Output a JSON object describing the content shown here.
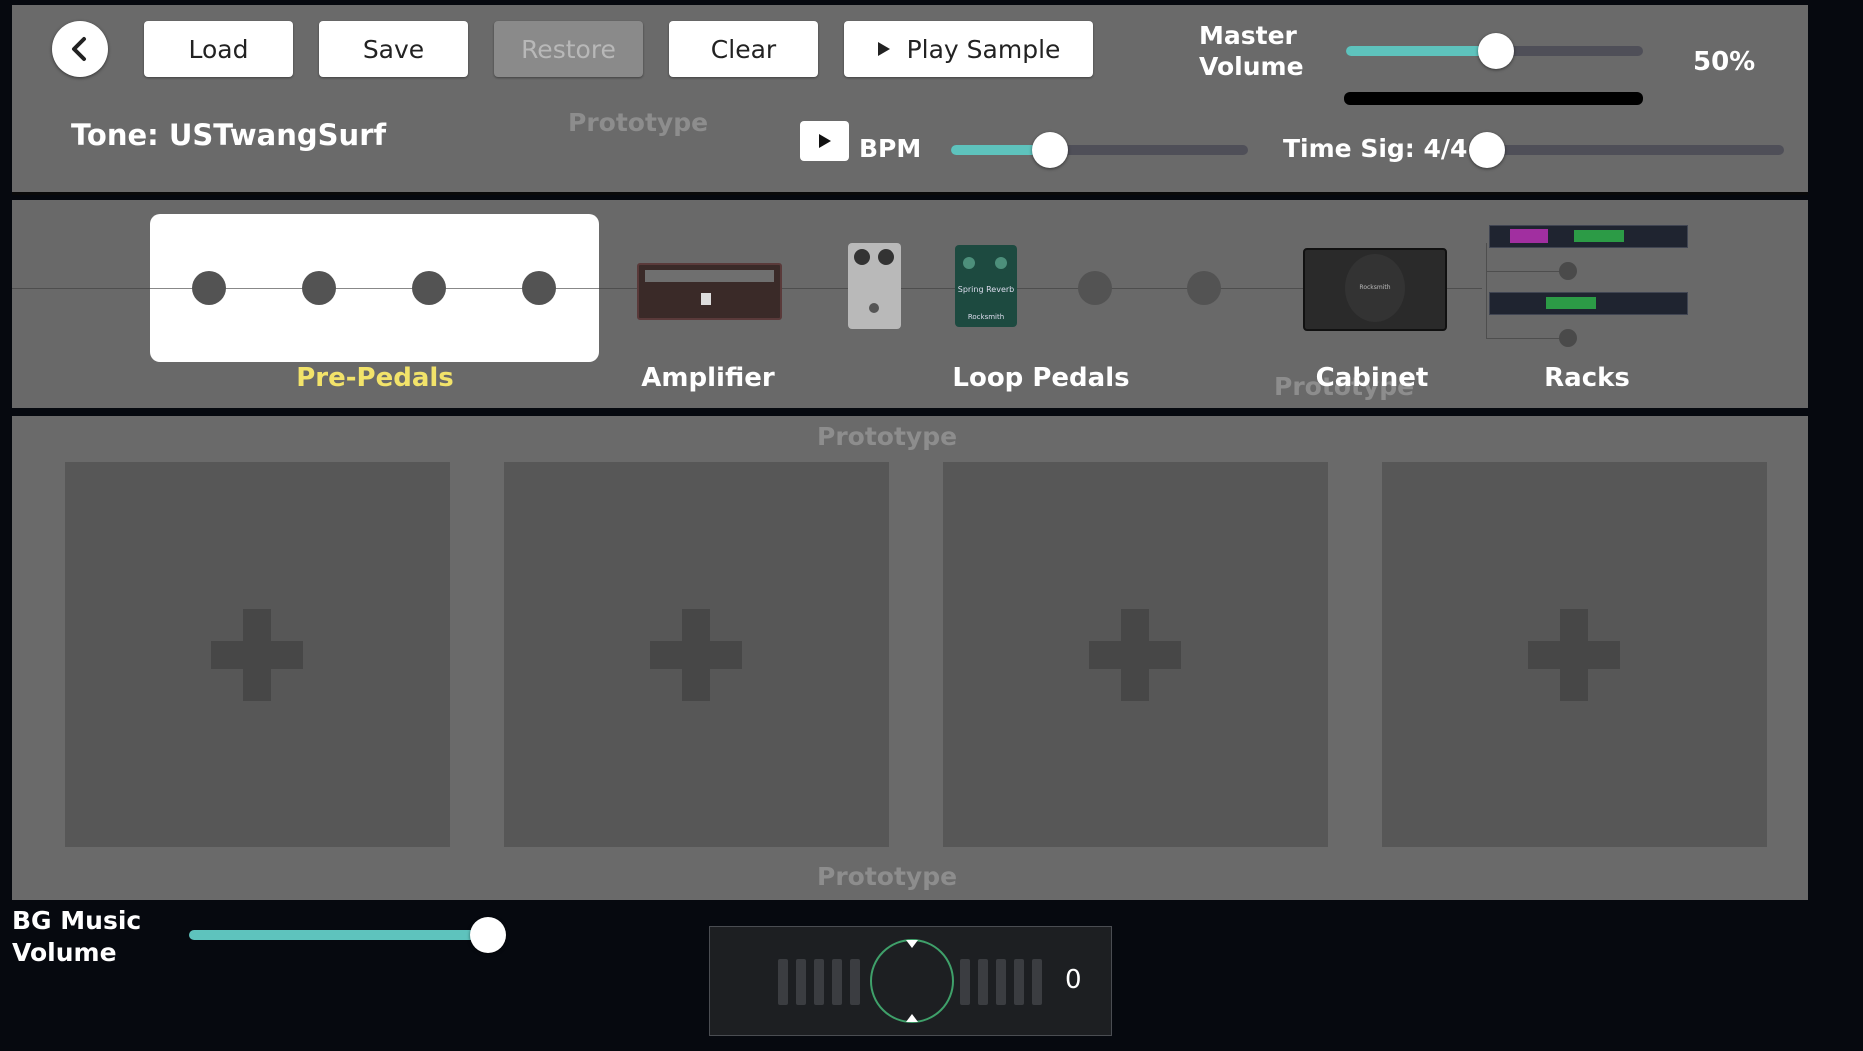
{
  "toolbar": {
    "load_label": "Load",
    "save_label": "Save",
    "restore_label": "Restore",
    "clear_label": "Clear",
    "play_sample_label": "Play Sample"
  },
  "master_volume": {
    "label_line1": "Master",
    "label_line2": "Volume",
    "value_text": "50%",
    "value": 0.5
  },
  "tone": {
    "name": "Tone: USTwangSurf"
  },
  "watermark": "Prototype",
  "bpm": {
    "label": "BPM",
    "value": 0.33
  },
  "time_sig": {
    "label": "Time Sig: 4/4",
    "value": 0.0
  },
  "chain": {
    "pre_pedals": "Pre-Pedals",
    "amplifier": "Amplifier",
    "loop_pedals": "Loop Pedals",
    "cabinet": "Cabinet",
    "racks": "Racks",
    "pedal_text": "Spring Reverb",
    "brand": "Rocksmith"
  },
  "bg_music": {
    "label_line1": "BG Music",
    "label_line2": "Volume",
    "value": 1.0
  },
  "tuner": {
    "value": "0"
  },
  "colors": {
    "accent": "#5ec3bd",
    "selected_label": "#f2e36a",
    "panel": "#6a6a6a"
  },
  "icons": {
    "back": "chevron-left-icon",
    "play": "play-icon",
    "add": "plus-icon"
  }
}
